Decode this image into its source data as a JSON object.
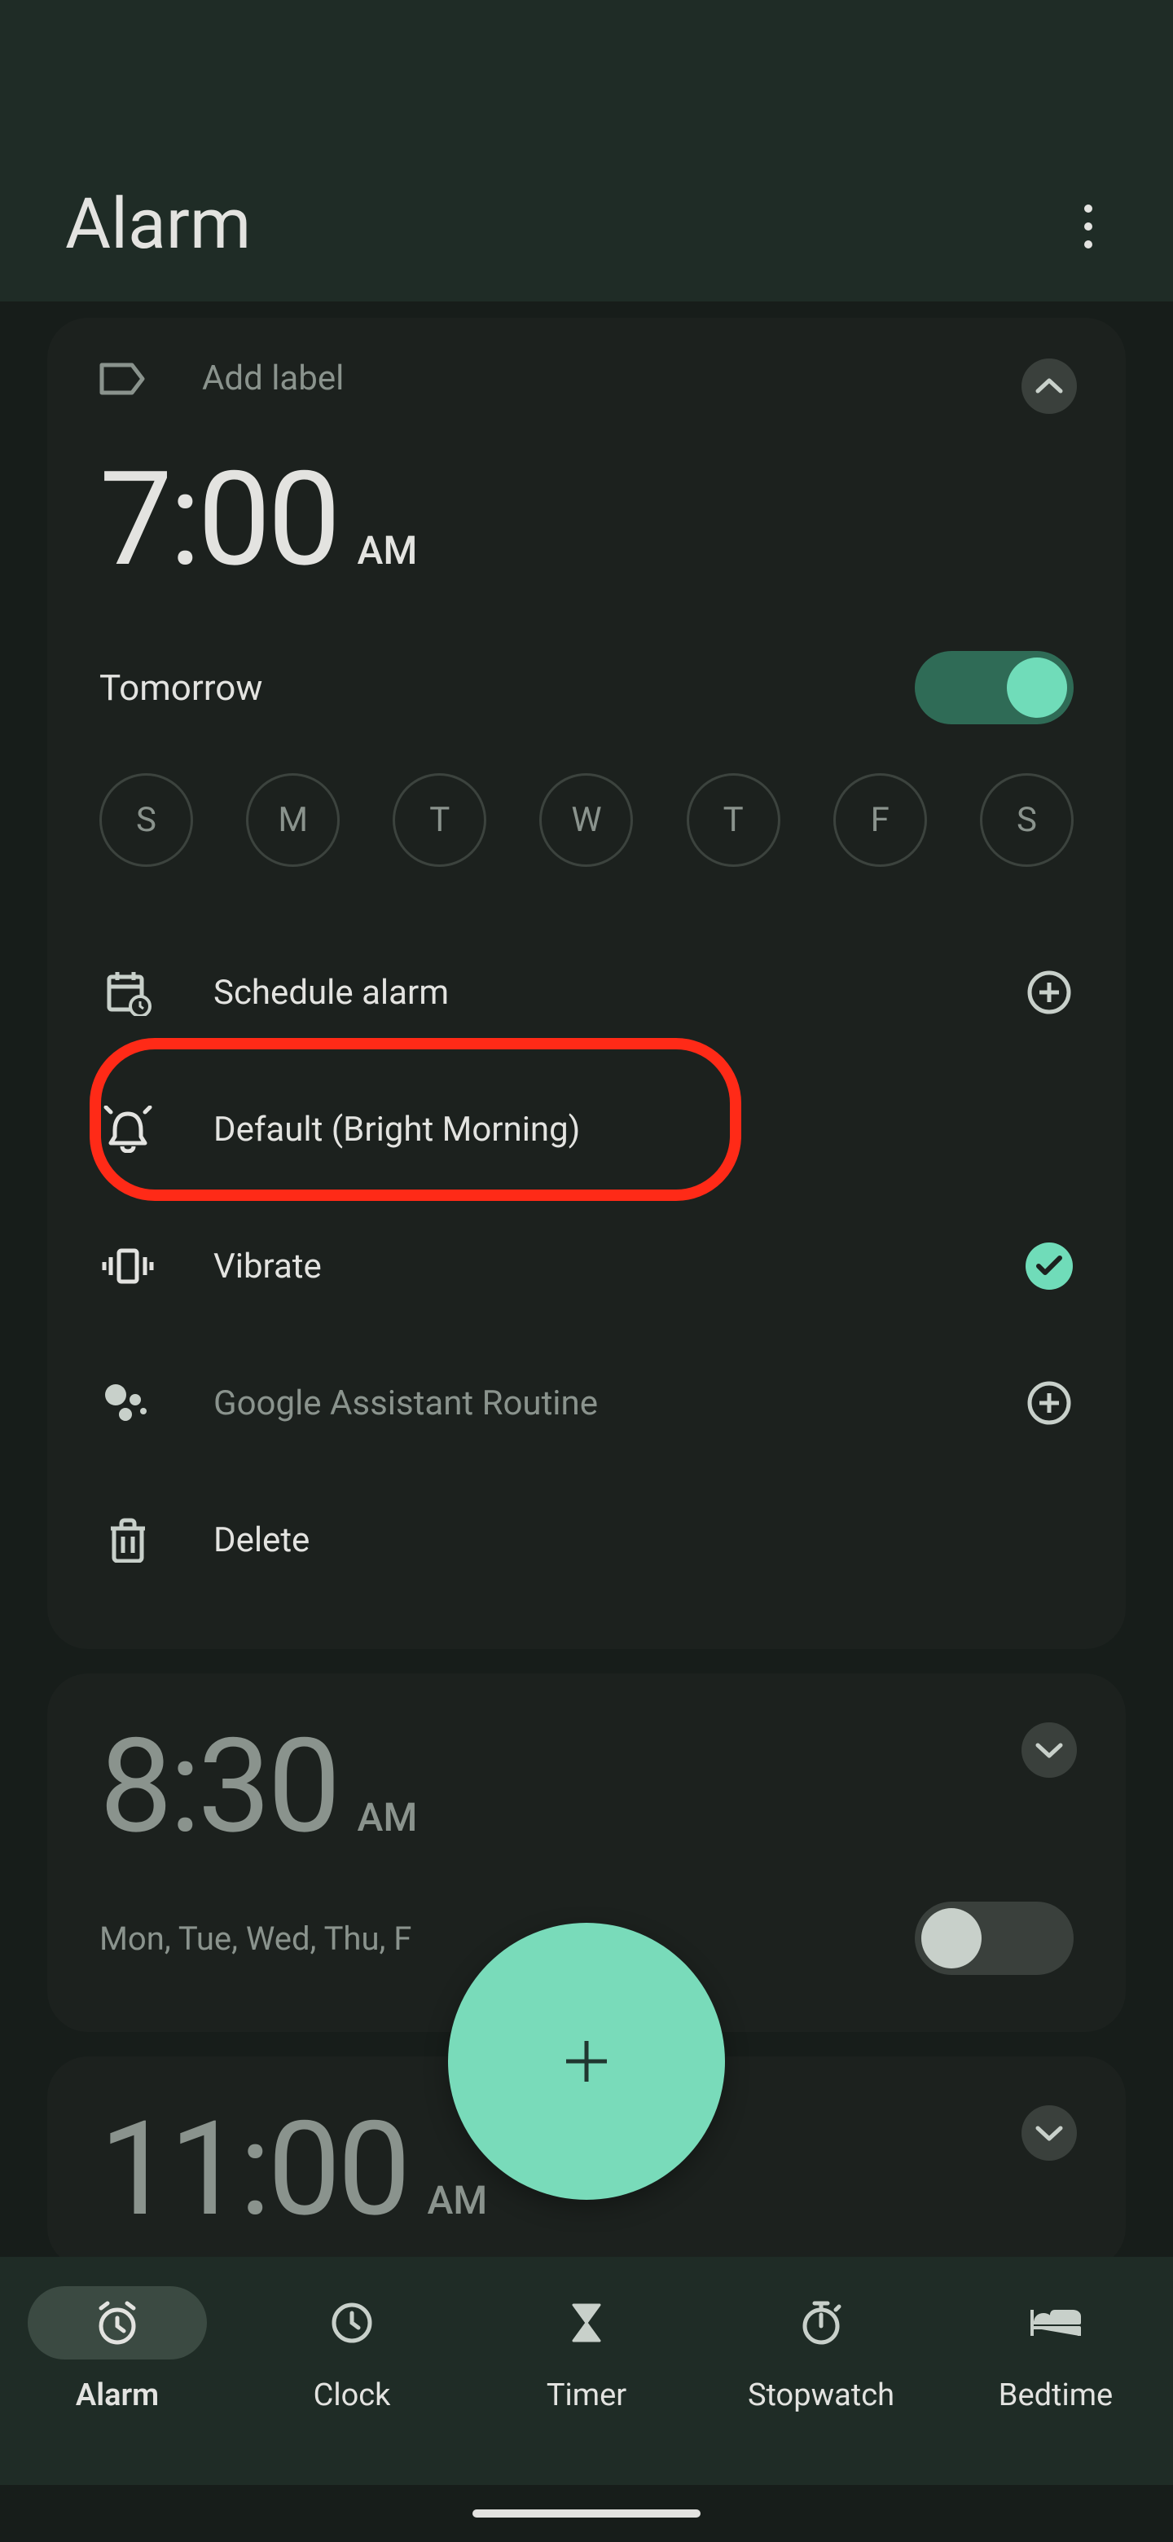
{
  "header": {
    "title": "Alarm"
  },
  "alarm1": {
    "label_placeholder": "Add label",
    "time": "7:00",
    "ampm": "AM",
    "schedule_text": "Tomorrow",
    "enabled": true,
    "days": [
      "S",
      "M",
      "T",
      "W",
      "T",
      "F",
      "S"
    ],
    "options": {
      "schedule": "Schedule alarm",
      "sound": "Default (Bright Morning)",
      "vibrate": "Vibrate",
      "assistant": "Google Assistant Routine",
      "delete": "Delete"
    }
  },
  "alarm2": {
    "time": "8:30",
    "ampm": "AM",
    "schedule_text": "Mon, Tue, Wed, Thu, F",
    "enabled": false
  },
  "alarm3": {
    "time": "11:00",
    "ampm": "AM"
  },
  "nav": {
    "alarm": "Alarm",
    "clock": "Clock",
    "timer": "Timer",
    "stopwatch": "Stopwatch",
    "bedtime": "Bedtime"
  }
}
